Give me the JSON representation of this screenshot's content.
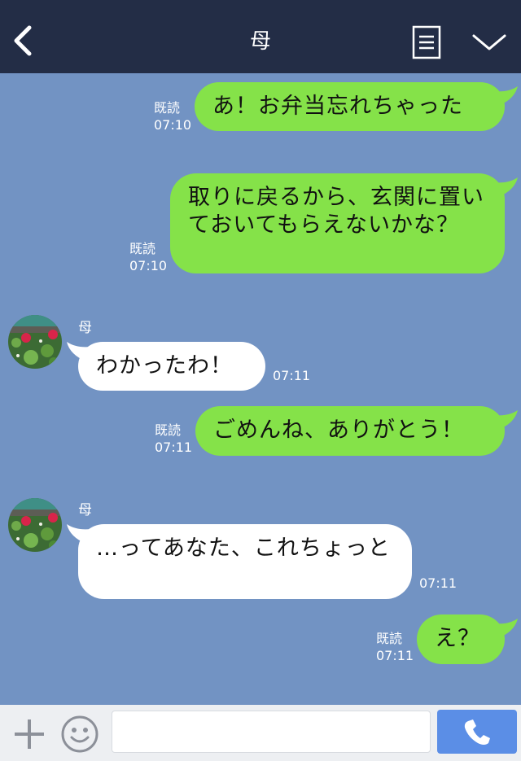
{
  "header": {
    "title": "母",
    "background": "#232d46"
  },
  "colors": {
    "chat_background": "#7293c3",
    "outgoing_bubble": "#85e249",
    "incoming_bubble": "#ffffff",
    "call_button": "#5b8ee6"
  },
  "messages": [
    {
      "direction": "out",
      "text": "あ！お弁当忘れちゃった",
      "read_label": "既読",
      "time": "07:10"
    },
    {
      "direction": "out",
      "text": "取りに戻るから、玄関に置いておいてもらえないかな？",
      "read_label": "既読",
      "time": "07:10"
    },
    {
      "direction": "in",
      "sender": "母",
      "text": "わかったわ！",
      "time": "07:11"
    },
    {
      "direction": "out",
      "text": "ごめんね、ありがとう！",
      "read_label": "既読",
      "time": "07:11"
    },
    {
      "direction": "in",
      "sender": "母",
      "text": "…ってあなた、これちょっと",
      "time": "07:11"
    },
    {
      "direction": "out",
      "text": "え？",
      "read_label": "既読",
      "time": "07:11"
    }
  ],
  "input": {
    "value": "",
    "placeholder": ""
  },
  "icons": {
    "back": "chevron-left-icon",
    "menu": "menu-document-icon",
    "collapse": "chevron-down-icon",
    "add": "plus-icon",
    "emoji": "smiley-icon",
    "call": "phone-icon"
  }
}
